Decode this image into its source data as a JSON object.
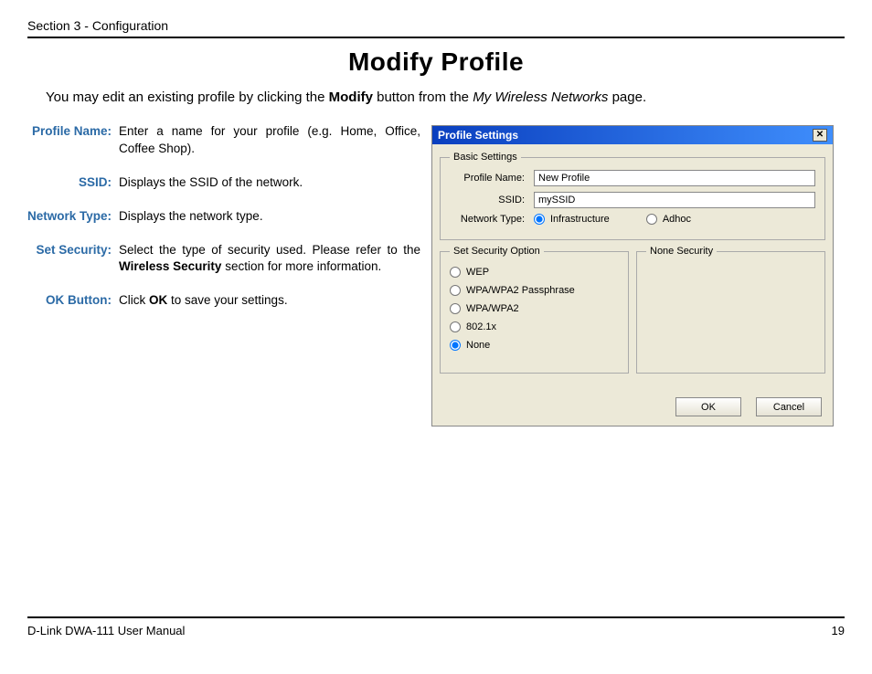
{
  "header": {
    "section": "Section 3 - Configuration"
  },
  "title": "Modify Profile",
  "intro": {
    "pre": "You may edit an existing profile by clicking the ",
    "bold": "Modify",
    "mid": " button from the ",
    "italic": "My Wireless Networks",
    "post": " page."
  },
  "defs": {
    "profile_name": {
      "label": "Profile Name:",
      "text": "Enter a name for your profile (e.g. Home, Office, Coffee Shop)."
    },
    "ssid": {
      "label": "SSID:",
      "text": "Displays the SSID of the network."
    },
    "network_type": {
      "label": "Network Type:",
      "text": "Displays the network type."
    },
    "set_security": {
      "label": "Set Security:",
      "pre": "Select the type of security used. Please refer to the ",
      "bold": "Wireless Security",
      "post": " section for more information."
    },
    "ok_button": {
      "label": "OK Button:",
      "pre": "Click ",
      "bold": "OK",
      "post": " to save your settings."
    }
  },
  "dialog": {
    "title": "Profile Settings",
    "basic_legend": "Basic Settings",
    "labels": {
      "profile_name": "Profile Name:",
      "ssid": "SSID:",
      "network_type": "Network Type:"
    },
    "values": {
      "profile_name": "New Profile",
      "ssid": "mySSID"
    },
    "network_types": {
      "infrastructure": "Infrastructure",
      "adhoc": "Adhoc"
    },
    "security_legend": "Set Security Option",
    "none_legend": "None Security",
    "security_options": {
      "wep": "WEP",
      "wpa_pass": "WPA/WPA2 Passphrase",
      "wpa": "WPA/WPA2",
      "dot1x": "802.1x",
      "none": "None"
    },
    "buttons": {
      "ok": "OK",
      "cancel": "Cancel"
    }
  },
  "footer": {
    "left": "D-Link DWA-111 User Manual",
    "page": "19"
  }
}
